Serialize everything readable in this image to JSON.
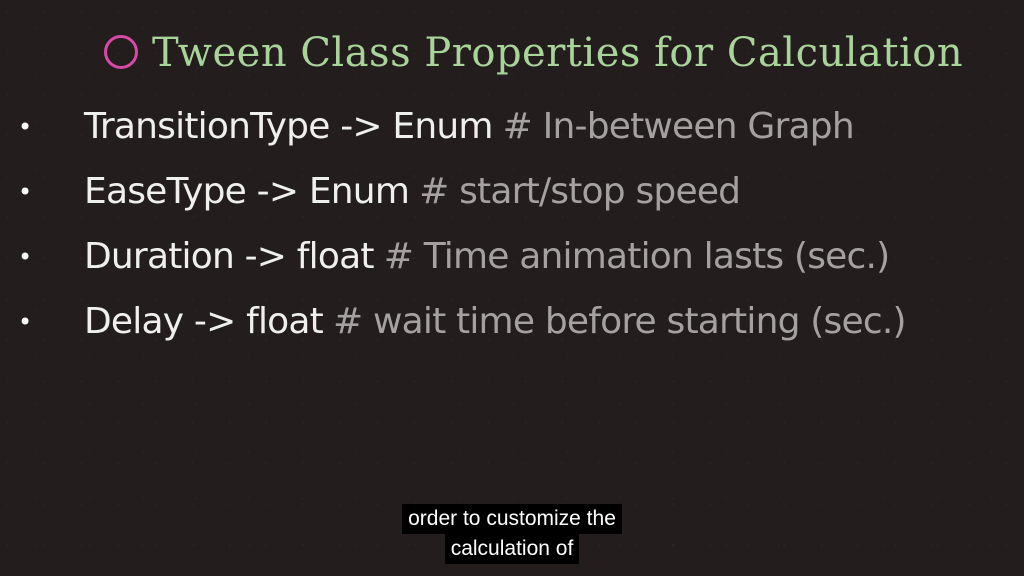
{
  "slide": {
    "title": "Tween Class Properties for Calculation",
    "title_icon": "hollow-circle",
    "bullet_glyph": "•",
    "items": [
      {
        "main": "TransitionType -> Enum",
        "comment": "# In-between Graph"
      },
      {
        "main": "EaseType ->  Enum",
        "comment": "# start/stop speed"
      },
      {
        "main": "Duration -> float",
        "comment": "# Time animation lasts (sec.)"
      },
      {
        "main": "Delay -> float",
        "comment": "# wait time before starting (sec.)"
      }
    ]
  },
  "caption": {
    "lines": [
      "order to customize the",
      "calculation of"
    ]
  },
  "colors": {
    "background": "#241d1d",
    "title": "#a8d49a",
    "title_circle": "#d94aa6",
    "main_text": "#efefef",
    "comment_text": "#a5a1a1",
    "caption_bg": "#000000",
    "caption_text": "#ffffff"
  }
}
